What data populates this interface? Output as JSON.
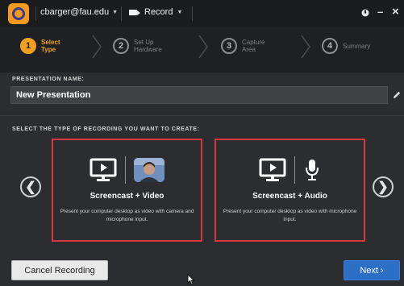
{
  "titlebar": {
    "account": "cbarger@fau.edu",
    "record_menu": "Record",
    "icons": [
      "app-logo",
      "dropdown-caret",
      "camera-icon",
      "status-dot-icon",
      "minimize-icon",
      "close-icon"
    ],
    "close_glyph": "×",
    "minimize_glyph": "–"
  },
  "steps": [
    {
      "number": "1",
      "line1": "Select",
      "line2": "Type",
      "active": true
    },
    {
      "number": "2",
      "line1": "Set Up",
      "line2": "Hardware",
      "active": false
    },
    {
      "number": "3",
      "line1": "Capture",
      "line2": "Area",
      "active": false
    },
    {
      "number": "4",
      "line1": "Summary",
      "line2": "",
      "active": false
    }
  ],
  "presentation": {
    "label": "PRESENTATION NAME:",
    "value": "New Presentation"
  },
  "recording_type": {
    "label": "SELECT THE TYPE OF RECORDING YOU WANT TO CREATE:",
    "options": [
      {
        "title": "Screencast + Video",
        "description": "Present your computer desktop as video with camera and microphone input."
      },
      {
        "title": "Screencast + Audio",
        "description": "Present your computer desktop as video with microphone input."
      }
    ],
    "prev_glyph": "❮",
    "next_glyph": "❯"
  },
  "footer": {
    "cancel_label": "Cancel Recording",
    "next_label": "Next ›"
  },
  "colors": {
    "accent": "#f2a11f",
    "selection_border": "#d6383c",
    "primary_button": "#2d6fc6"
  }
}
